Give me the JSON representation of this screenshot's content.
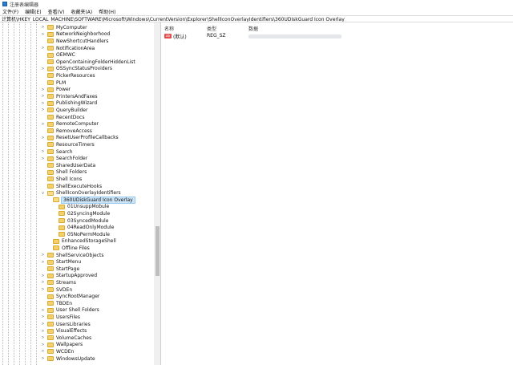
{
  "window": {
    "title": "注册表编辑器"
  },
  "menu": [
    "文件(F)",
    "编辑(E)",
    "查看(V)",
    "收藏夹(A)",
    "帮助(H)"
  ],
  "address": "计算机\\HKEY_LOCAL_MACHINE\\SOFTWARE\\Microsoft\\Windows\\CurrentVersion\\Explorer\\ShellIconOverlayIdentifiers\\360UDiskGuard Icon Overlay",
  "tree": [
    {
      "label": "MyComputer",
      "level": 0,
      "expander": ">"
    },
    {
      "label": "NetworkNeighborhood",
      "level": 0,
      "expander": ">"
    },
    {
      "label": "NewShortcutHandlers",
      "level": 0,
      "expander": ""
    },
    {
      "label": "NotificationArea",
      "level": 0,
      "expander": ">"
    },
    {
      "label": "OEMWC",
      "level": 0,
      "expander": ""
    },
    {
      "label": "OpenContainingFolderHiddenList",
      "level": 0,
      "expander": ""
    },
    {
      "label": "OSSyncStatusProviders",
      "level": 0,
      "expander": ">"
    },
    {
      "label": "PickerResources",
      "level": 0,
      "expander": ""
    },
    {
      "label": "PLM",
      "level": 0,
      "expander": ""
    },
    {
      "label": "Power",
      "level": 0,
      "expander": ">"
    },
    {
      "label": "PrintersAndFaxes",
      "level": 0,
      "expander": ">"
    },
    {
      "label": "PublishingWizard",
      "level": 0,
      "expander": ">"
    },
    {
      "label": "QueryBuilder",
      "level": 0,
      "expander": ">"
    },
    {
      "label": "RecentDocs",
      "level": 0,
      "expander": ""
    },
    {
      "label": "RemoteComputer",
      "level": 0,
      "expander": ">"
    },
    {
      "label": "RemoveAccess",
      "level": 0,
      "expander": ""
    },
    {
      "label": "ResetUserProfileCallbacks",
      "level": 0,
      "expander": ">"
    },
    {
      "label": "ResourceTimers",
      "level": 0,
      "expander": ""
    },
    {
      "label": "Search",
      "level": 0,
      "expander": ">"
    },
    {
      "label": "SearchFolder",
      "level": 0,
      "expander": ">"
    },
    {
      "label": "SharedUserData",
      "level": 0,
      "expander": ""
    },
    {
      "label": "Shell Folders",
      "level": 0,
      "expander": ""
    },
    {
      "label": "Shell Icons",
      "level": 0,
      "expander": ""
    },
    {
      "label": "ShellExecuteHooks",
      "level": 0,
      "expander": ""
    },
    {
      "label": "ShellIconOverlayIdentifiers",
      "level": 0,
      "expander": "v",
      "open": true
    },
    {
      "label": "360UDiskGuard Icon Overlay",
      "level": 1,
      "expander": "",
      "selected": true,
      "open": true
    },
    {
      "label": "01UnsuppMobule",
      "level": 2,
      "expander": ""
    },
    {
      "label": "02SyncingModule",
      "level": 2,
      "expander": ""
    },
    {
      "label": "03SyncedModule",
      "level": 2,
      "expander": ""
    },
    {
      "label": "04ReadOnlyModule",
      "level": 2,
      "expander": ""
    },
    {
      "label": "05NoPermModule",
      "level": 2,
      "expander": ""
    },
    {
      "label": "EnhancedStorageShell",
      "level": 1,
      "expander": ""
    },
    {
      "label": "Offline Files",
      "level": 1,
      "expander": ""
    },
    {
      "label": "ShellServiceObjects",
      "level": 0,
      "expander": ">"
    },
    {
      "label": "StartMenu",
      "level": 0,
      "expander": ">"
    },
    {
      "label": "StartPage",
      "level": 0,
      "expander": ""
    },
    {
      "label": "StartupApproved",
      "level": 0,
      "expander": ">"
    },
    {
      "label": "Streams",
      "level": 0,
      "expander": ">"
    },
    {
      "label": "SVDEn",
      "level": 0,
      "expander": ">"
    },
    {
      "label": "SyncRootManager",
      "level": 0,
      "expander": ""
    },
    {
      "label": "TBDEn",
      "level": 0,
      "expander": ""
    },
    {
      "label": "User Shell Folders",
      "level": 0,
      "expander": ">"
    },
    {
      "label": "UsersFiles",
      "level": 0,
      "expander": ">"
    },
    {
      "label": "UsersLibraries",
      "level": 0,
      "expander": ">"
    },
    {
      "label": "VisualEffects",
      "level": 0,
      "expander": ">"
    },
    {
      "label": "VolumeCaches",
      "level": 0,
      "expander": ">"
    },
    {
      "label": "Wallpapers",
      "level": 0,
      "expander": ">"
    },
    {
      "label": "WCDEn",
      "level": 0,
      "expander": ">"
    },
    {
      "label": "WindowsUpdate",
      "level": 0,
      "expander": ">"
    }
  ],
  "values": {
    "headers": {
      "name": "名称",
      "type": "类型",
      "data": "数据"
    },
    "rows": [
      {
        "icon": "ab",
        "name": "(默认)",
        "type": "REG_SZ"
      }
    ]
  }
}
